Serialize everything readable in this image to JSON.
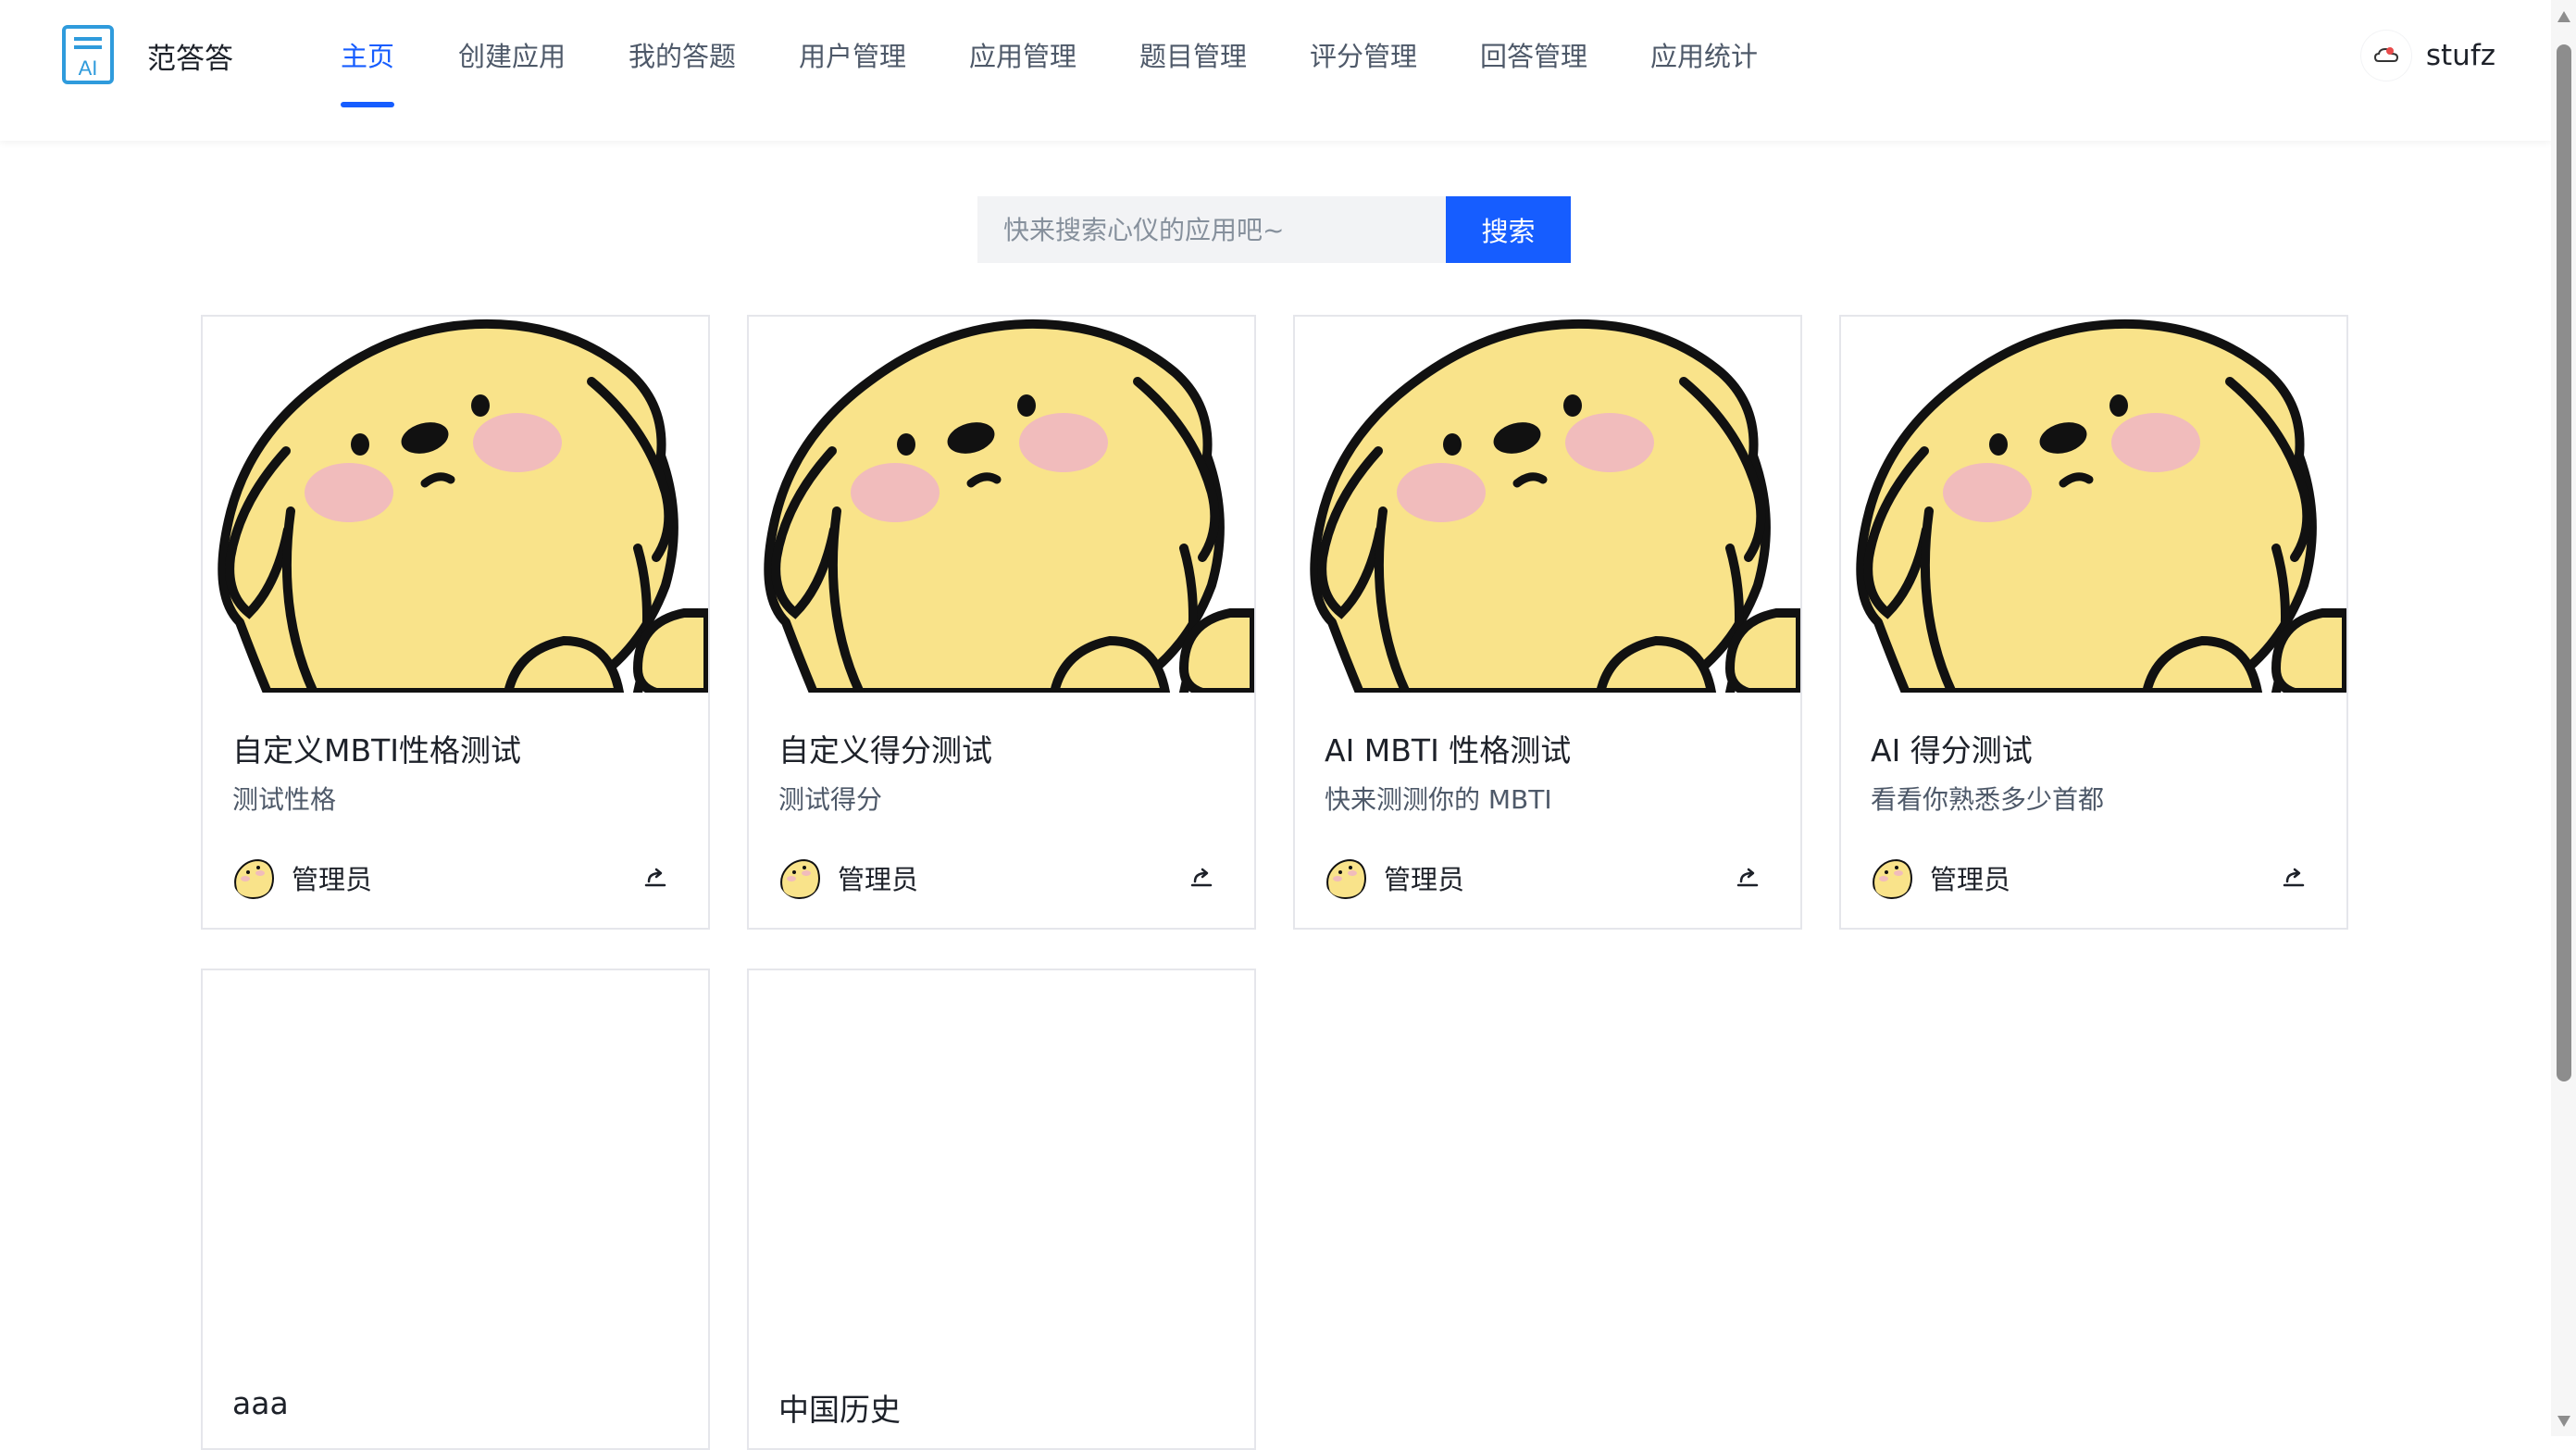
{
  "header": {
    "app_name": "范答答",
    "nav": [
      {
        "label": "主页",
        "active": true
      },
      {
        "label": "创建应用",
        "active": false
      },
      {
        "label": "我的答题",
        "active": false
      },
      {
        "label": "用户管理",
        "active": false
      },
      {
        "label": "应用管理",
        "active": false
      },
      {
        "label": "题目管理",
        "active": false
      },
      {
        "label": "评分管理",
        "active": false
      },
      {
        "label": "回答管理",
        "active": false
      },
      {
        "label": "应用统计",
        "active": false
      }
    ],
    "user_name": "stufz"
  },
  "search": {
    "placeholder": "快来搜索心仪的应用吧~",
    "button_label": "搜索"
  },
  "apps": [
    {
      "title": "自定义MBTI性格测试",
      "description": "测试性格",
      "author": "管理员",
      "has_cover": true
    },
    {
      "title": "自定义得分测试",
      "description": "测试得分",
      "author": "管理员",
      "has_cover": true
    },
    {
      "title": "AI MBTI 性格测试",
      "description": "快来测测你的 MBTI",
      "author": "管理员",
      "has_cover": true
    },
    {
      "title": "AI 得分测试",
      "description": "看看你熟悉多少首都",
      "author": "管理员",
      "has_cover": true
    },
    {
      "title": "aaa",
      "has_cover": false
    },
    {
      "title": "中国历史",
      "has_cover": false
    }
  ],
  "colors": {
    "primary": "#165dff",
    "dog_yellow": "#f9e38a",
    "blush": "#f1bcbc"
  },
  "icons": {
    "logo": "ai-document-icon",
    "share": "share-icon",
    "user_avatar": "cloud-avatar-icon"
  }
}
